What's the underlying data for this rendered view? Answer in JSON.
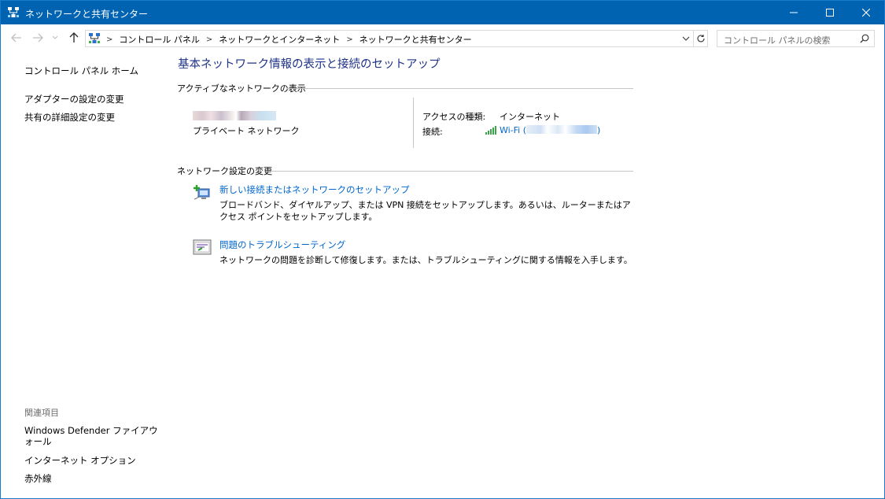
{
  "window": {
    "title": "ネットワークと共有センター",
    "colors": {
      "titlebar": "#0063b1",
      "link": "#0066cc",
      "heading": "#1e3287"
    }
  },
  "address": {
    "crumbs": [
      "コントロール パネル",
      "ネットワークとインターネット",
      "ネットワークと共有センター"
    ]
  },
  "search": {
    "placeholder": "コントロール パネルの検索"
  },
  "sidebar": {
    "home": "コントロール パネル ホーム",
    "items": [
      "アダプターの設定の変更",
      "共有の詳細設定の変更"
    ],
    "related_heading": "関連項目",
    "related": [
      "Windows Defender ファイアウォール",
      "インターネット オプション",
      "赤外線"
    ]
  },
  "main": {
    "title": "基本ネットワーク情報の表示と接続のセットアップ",
    "active_heading": "アクティブなネットワークの表示",
    "network": {
      "type": "プライベート ネットワーク",
      "access_label": "アクセスの種類:",
      "access_value": "インターネット",
      "conn_label": "接続:",
      "conn_prefix": "Wi-Fi (",
      "conn_suffix": ")"
    },
    "change_heading": "ネットワーク設定の変更",
    "tasks": [
      {
        "link": "新しい接続またはネットワークのセットアップ",
        "desc": "ブロードバンド、ダイヤルアップ、または VPN 接続をセットアップします。あるいは、ルーターまたはアクセス ポイントをセットアップします。",
        "icon": "new-connection-icon"
      },
      {
        "link": "問題のトラブルシューティング",
        "desc": "ネットワークの問題を診断して修復します。または、トラブルシューティングに関する情報を入手します。",
        "icon": "troubleshoot-icon"
      }
    ]
  }
}
